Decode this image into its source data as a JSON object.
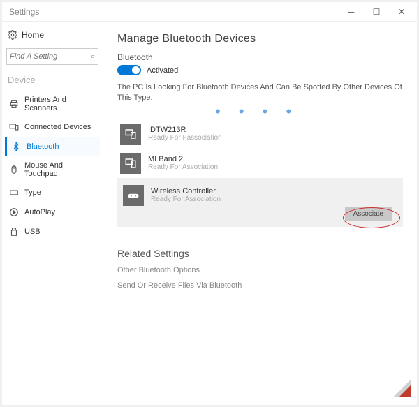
{
  "window": {
    "title": "Settings"
  },
  "sidebar": {
    "home_label": "Home",
    "search_placeholder": "Find A Setting",
    "section_label": "Device",
    "items": [
      {
        "label": "Printers And Scanners",
        "icon": "printer"
      },
      {
        "label": "Connected Devices",
        "icon": "devices"
      },
      {
        "label": "Bluetooth",
        "icon": "bluetooth",
        "active": true
      },
      {
        "label": "Mouse And Touchpad",
        "icon": "mouse"
      },
      {
        "label": "Type",
        "icon": "keyboard"
      },
      {
        "label": "AutoPlay",
        "icon": "autoplay"
      },
      {
        "label": "USB",
        "icon": "usb"
      }
    ]
  },
  "main": {
    "heading": "Manage Bluetooth Devices",
    "bluetooth_label": "Bluetooth",
    "toggle_state": "Activated",
    "description": "The PC Is Looking For Bluetooth Devices And Can Be Spotted By Other Devices Of This Type.",
    "devices": [
      {
        "name": "IDTW213R",
        "status": "Ready For Fassociation",
        "icon": "display"
      },
      {
        "name": "MI Band 2",
        "status": "Ready For Association",
        "icon": "phone"
      },
      {
        "name": "Wireless Controller",
        "status": "Ready For Association",
        "icon": "gamepad",
        "selected": true
      }
    ],
    "associate_label": "Associate"
  },
  "related": {
    "heading": "Related Settings",
    "links": [
      "Other Bluetooth Options",
      "Send Or Receive Files Via Bluetooth"
    ]
  }
}
